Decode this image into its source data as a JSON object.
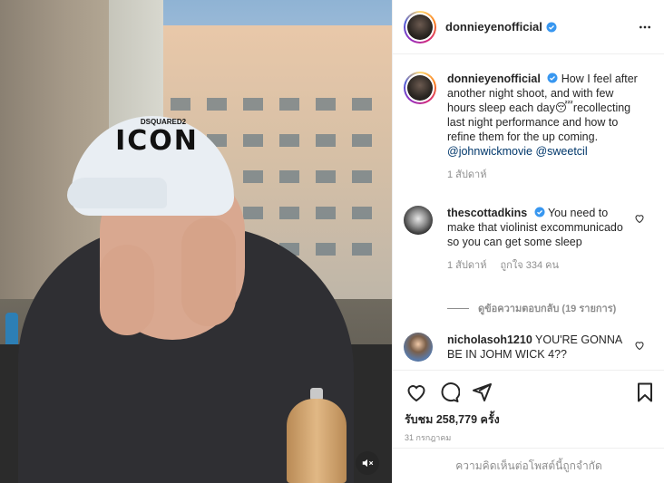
{
  "post": {
    "username": "donnieyenofficial",
    "verified": true,
    "more_icon": "more-horizontal-icon"
  },
  "media": {
    "cap_text": "ICON",
    "cap_small_text": "DSQUARED2",
    "mute_icon": "volume-muted-icon"
  },
  "caption": {
    "username": "donnieyenofficial",
    "text": "How I feel after another night shoot, and with few hours sleep each day",
    "emoji": "😴",
    "text2": "recollecting last night performance and how to refine them for the up coming.",
    "mentions": [
      "@johnwickmovie",
      "@sweetcil"
    ],
    "time": "1 สัปดาห์"
  },
  "comments": [
    {
      "username": "thescottadkins",
      "verified": true,
      "text": "You need to make that violinist excommunicado so you can get some sleep",
      "time": "1 สัปดาห์",
      "likes": "ถูกใจ 334 คน"
    },
    {
      "username": "nicholasoh1210",
      "verified": false,
      "text": "YOU'RE GONNA BE IN JOHM WICK 4??"
    }
  ],
  "view_replies": "ดูข้อความตอบกลับ (19 รายการ)",
  "actions": {
    "icons": [
      "heart-icon",
      "comment-icon",
      "share-icon",
      "bookmark-icon"
    ],
    "views": "รับชม 258,779 ครั้ง",
    "date": "31 กรกฎาคม"
  },
  "comments_disabled": "ความคิดเห็นต่อโพสต์นี้ถูกจำกัด",
  "colors": {
    "verified_blue": "#3897f0",
    "mention_blue": "#00376b",
    "secondary_text": "#8e8e8e"
  }
}
